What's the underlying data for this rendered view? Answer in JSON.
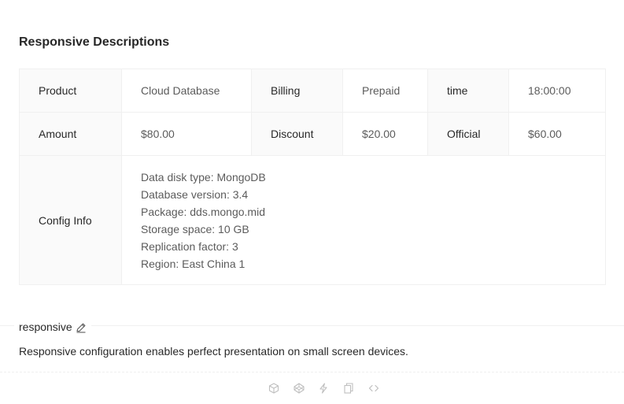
{
  "descriptions": {
    "title": "Responsive Descriptions",
    "rows": [
      [
        {
          "label": "Product",
          "value": "Cloud Database"
        },
        {
          "label": "Billing",
          "value": "Prepaid"
        },
        {
          "label": "time",
          "value": "18:00:00"
        }
      ],
      [
        {
          "label": "Amount",
          "value": "$80.00"
        },
        {
          "label": "Discount",
          "value": "$20.00"
        },
        {
          "label": "Official",
          "value": "$60.00"
        }
      ]
    ],
    "config": {
      "label": "Config Info",
      "lines": [
        "Data disk type: MongoDB",
        "Database version: 3.4",
        "Package: dds.mongo.mid",
        "Storage space: 10 GB",
        "Replication factor: 3",
        "Region: East China 1"
      ]
    }
  },
  "demo_meta": {
    "title": "responsive",
    "description": "Responsive configuration enables perfect presentation on small screen devices."
  },
  "actions": [
    {
      "icon": "codesandbox-icon"
    },
    {
      "icon": "codepen-icon"
    },
    {
      "icon": "thunderbolt-icon"
    },
    {
      "icon": "copy-icon"
    },
    {
      "icon": "expand-code-icon"
    }
  ],
  "colors": {
    "label_bg": "#fafafa",
    "border": "#f0f0f0",
    "icon": "#bfbfbf"
  }
}
